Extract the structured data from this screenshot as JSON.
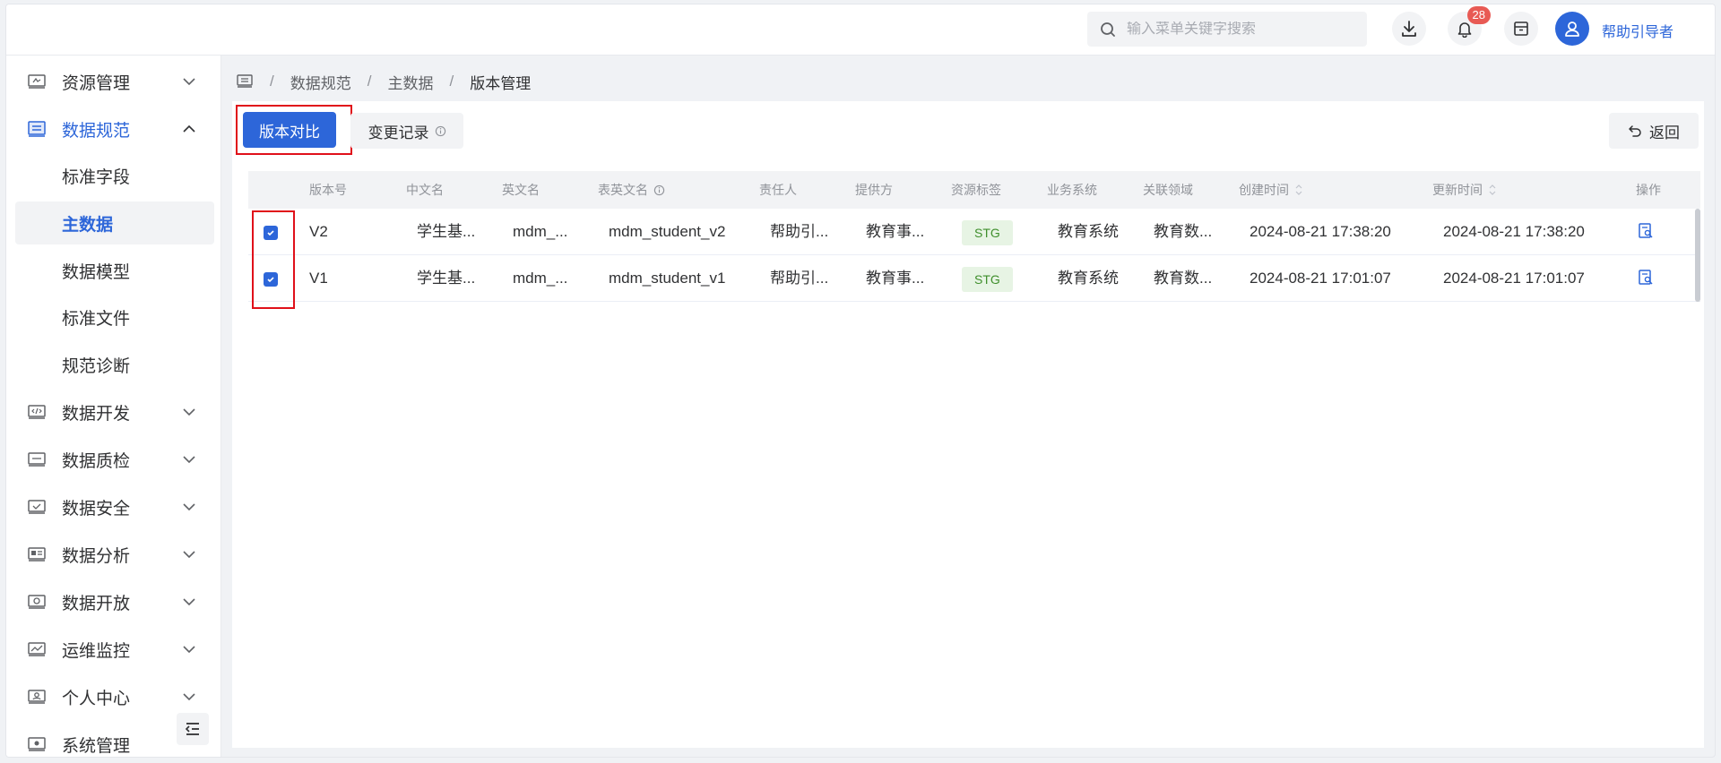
{
  "header": {
    "search_placeholder": "输入菜单关键字搜索",
    "notification_count": "28",
    "username": "帮助引导者"
  },
  "sidebar": {
    "items": [
      {
        "label": "资源管理",
        "icon": "resource-icon"
      },
      {
        "label": "数据规范",
        "icon": "database-icon"
      },
      {
        "label": "数据开发",
        "icon": "code-icon"
      },
      {
        "label": "数据质检",
        "icon": "inspection-icon"
      },
      {
        "label": "数据安全",
        "icon": "security-icon"
      },
      {
        "label": "数据分析",
        "icon": "analysis-icon"
      },
      {
        "label": "数据开放",
        "icon": "open-icon"
      },
      {
        "label": "运维监控",
        "icon": "monitor-icon"
      },
      {
        "label": "个人中心",
        "icon": "person-icon"
      },
      {
        "label": "系统管理",
        "icon": "settings-icon"
      }
    ],
    "sub_items": [
      "标准字段",
      "主数据",
      "数据模型",
      "标准文件",
      "规范诊断"
    ],
    "active_item": "数据规范",
    "active_sub_item": "主数据"
  },
  "breadcrumb": {
    "items": [
      "数据规范",
      "主数据",
      "版本管理"
    ],
    "separator": "/"
  },
  "toolbar": {
    "compare_label": "版本对比",
    "history_label": "变更记录",
    "back_label": "返回"
  },
  "table": {
    "columns": [
      "版本号",
      "中文名",
      "英文名",
      "表英文名",
      "责任人",
      "提供方",
      "资源标签",
      "业务系统",
      "关联领域",
      "创建时间",
      "更新时间",
      "操作"
    ],
    "rows": [
      {
        "version": "V2",
        "cn_name": "学生基...",
        "en_name": "mdm_...",
        "table_name": "mdm_student_v2",
        "owner": "帮助引...",
        "provider": "教育事...",
        "tag": "STG",
        "system": "教育系统",
        "domain": "教育数...",
        "created": "2024-08-21 17:38:20",
        "updated": "2024-08-21 17:38:20",
        "checked": true
      },
      {
        "version": "V1",
        "cn_name": "学生基...",
        "en_name": "mdm_...",
        "table_name": "mdm_student_v1",
        "owner": "帮助引...",
        "provider": "教育事...",
        "tag": "STG",
        "system": "教育系统",
        "domain": "教育数...",
        "created": "2024-08-21 17:01:07",
        "updated": "2024-08-21 17:01:07",
        "checked": true
      }
    ]
  },
  "colors": {
    "accent": "#2d66d9",
    "highlight": "#e0101a",
    "badge": "#e85a54",
    "tag_bg": "#e7f4e4",
    "tag_text": "#3f8f2c"
  }
}
